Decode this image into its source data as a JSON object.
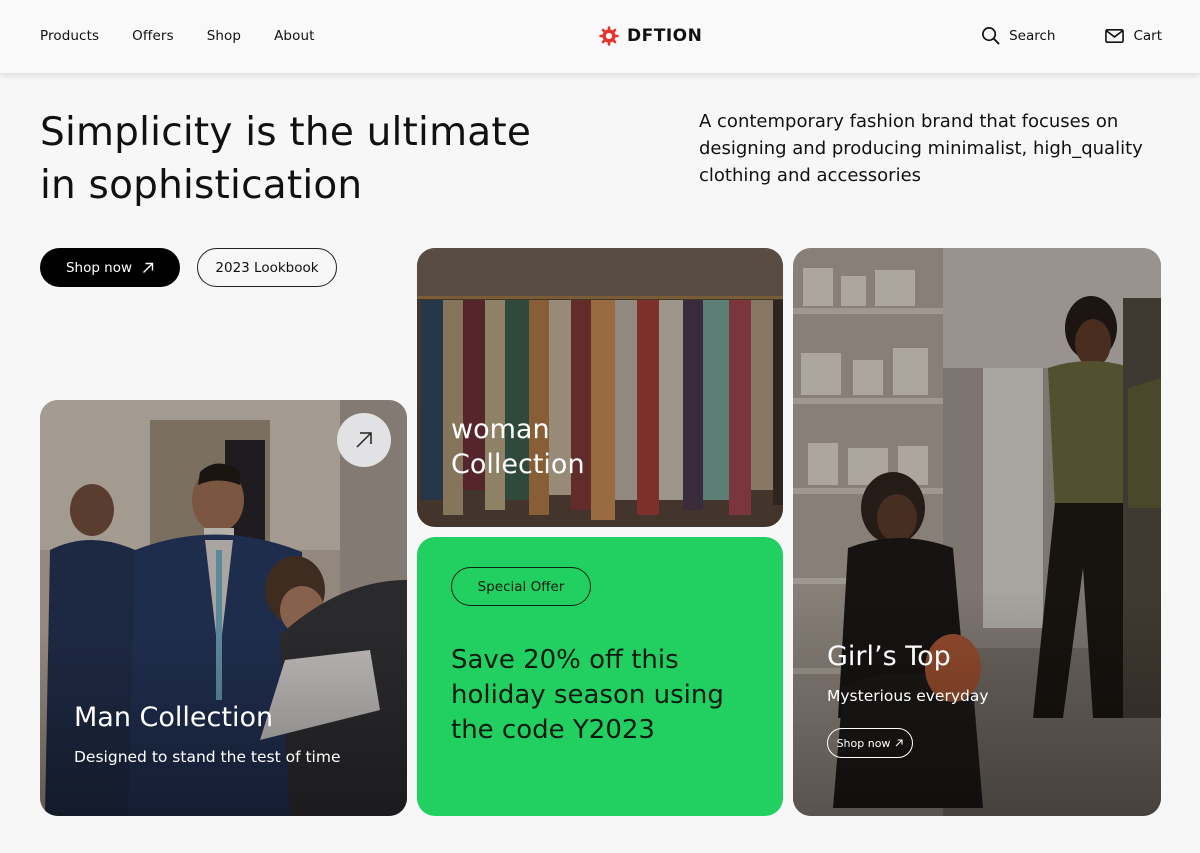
{
  "header": {
    "nav": [
      "Products",
      "Offers",
      "Shop",
      "About"
    ],
    "brand": "DFTION",
    "search_label": "Search",
    "cart_label": "Cart",
    "logo_color": "#e5322d"
  },
  "hero": {
    "title_line1": "Simplicity is the ultimate",
    "title_line2": "in sophistication",
    "description": "A contemporary fashion brand that focuses on designing and producing minimalist, high_quality clothing and accessories",
    "shop_now_label": "Shop now",
    "lookbook_label": "2023 Lookbook"
  },
  "cards": {
    "man": {
      "title": "Man Collection",
      "subtitle": "Designed to stand the test of time"
    },
    "woman": {
      "title_line1": "woman",
      "title_line2": "Collection"
    },
    "offer": {
      "pill": "Special Offer",
      "text": "Save 20% off this holiday season using the code Y2023",
      "background": "#22d061"
    },
    "girl": {
      "title": "Girl’s Top",
      "subtitle": "Mysterious everyday",
      "button": "Shop now"
    }
  }
}
